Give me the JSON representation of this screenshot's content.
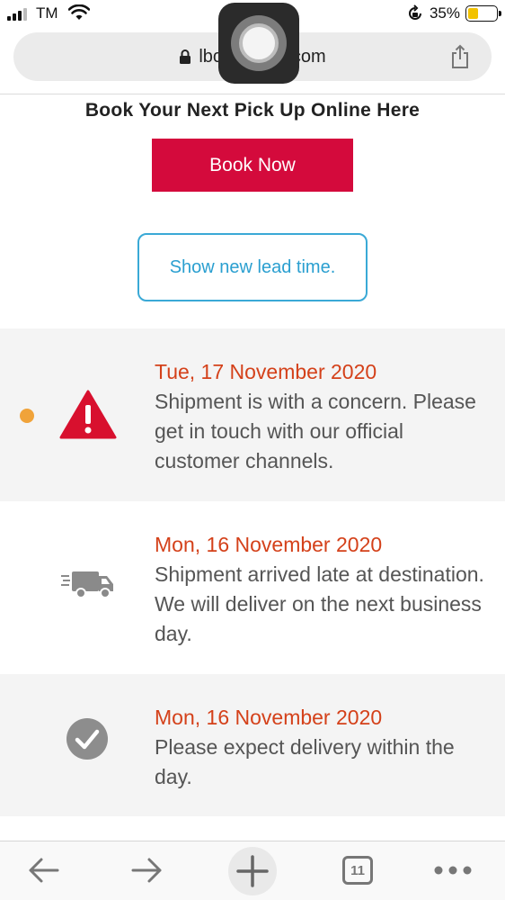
{
  "status_bar": {
    "carrier": "TM",
    "battery_percent": "35%",
    "battery_level": 0.35
  },
  "url_bar": {
    "url_prefix": "lbc",
    "url_suffix": "com"
  },
  "book": {
    "heading": "Book Your Next Pick Up Online Here",
    "button_label": "Book Now",
    "lead_time_label": "Show new lead time."
  },
  "events": [
    {
      "date": "Tue, 17 November 2020",
      "message": "Shipment is with a concern. Please get in touch with our official customer channels.",
      "icon": "warning-triangle-icon"
    },
    {
      "date": "Mon, 16 November 2020",
      "message": "Shipment arrived late at destination. We will deliver on the next business day.",
      "icon": "delivery-truck-icon"
    },
    {
      "date": "Mon, 16 November 2020",
      "message": "Please expect delivery within the day.",
      "icon": "check-circle-icon"
    }
  ],
  "toolbar": {
    "tab_count": "11"
  },
  "colors": {
    "brand_red": "#d40a3c",
    "date_red": "#d4411a",
    "lead_blue": "#2a9fd0",
    "status_dot": "#f0a33a"
  }
}
